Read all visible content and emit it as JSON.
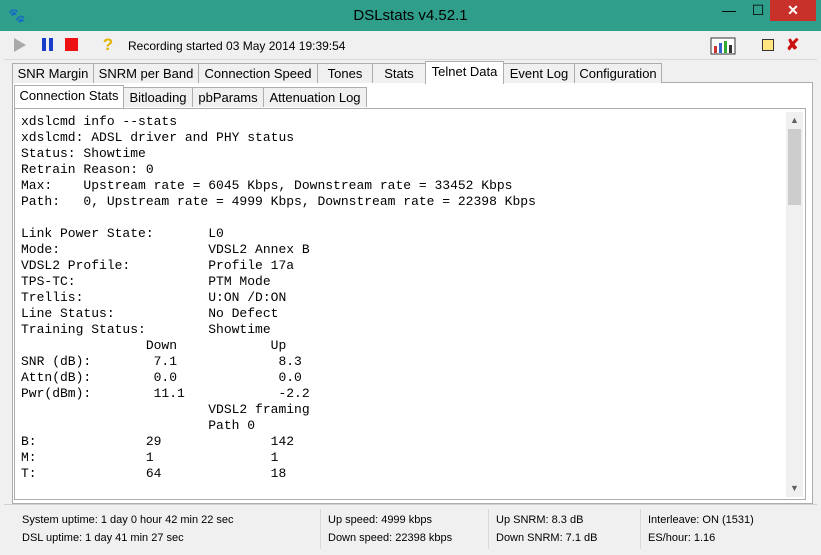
{
  "window": {
    "title": "DSLstats v4.52.1",
    "min_label": "—",
    "max_label": "☐",
    "close_label": "✕"
  },
  "toolbar": {
    "recording_text": "Recording started 03 May 2014 19:39:54",
    "help_glyph": "?",
    "exit_glyph": "✘"
  },
  "tabs": [
    {
      "label": "SNR Margin"
    },
    {
      "label": "SNRM per Band"
    },
    {
      "label": "Connection Speed"
    },
    {
      "label": "Tones"
    },
    {
      "label": "Stats"
    },
    {
      "label": "Telnet Data"
    },
    {
      "label": "Event Log"
    },
    {
      "label": "Configuration"
    }
  ],
  "active_tab": "Telnet Data",
  "subtabs": [
    {
      "label": "Connection Stats"
    },
    {
      "label": "Bitloading"
    },
    {
      "label": "pbParams"
    },
    {
      "label": "Attenuation Log"
    }
  ],
  "active_subtab": "Connection Stats",
  "telnet_output": "xdslcmd info --stats\nxdslcmd: ADSL driver and PHY status\nStatus: Showtime\nRetrain Reason: 0\nMax:    Upstream rate = 6045 Kbps, Downstream rate = 33452 Kbps\nPath:   0, Upstream rate = 4999 Kbps, Downstream rate = 22398 Kbps\n\nLink Power State:       L0\nMode:                   VDSL2 Annex B\nVDSL2 Profile:          Profile 17a\nTPS-TC:                 PTM Mode\nTrellis:                U:ON /D:ON\nLine Status:            No Defect\nTraining Status:        Showtime\n                Down            Up\nSNR (dB):        7.1             8.3\nAttn(dB):        0.0             0.0\nPwr(dBm):        11.1            -2.2\n                        VDSL2 framing\n                        Path 0\nB:              29              142\nM:              1               1\nT:              64              18",
  "status": {
    "system_uptime": "System uptime: 1 day 0 hour 42 min 22 sec",
    "dsl_uptime": "DSL uptime: 1 day 41 min 27 sec",
    "up_speed": "Up speed: 4999 kbps",
    "down_speed": "Down speed: 22398 kbps",
    "up_snrm": "Up SNRM: 8.3 dB",
    "down_snrm": "Down SNRM: 7.1 dB",
    "interleave": "Interleave: ON (1531)",
    "es_hour": "ES/hour: 1.16"
  },
  "colors": {
    "titlebar": "#2f9e8a",
    "close_button": "#c7312a"
  }
}
